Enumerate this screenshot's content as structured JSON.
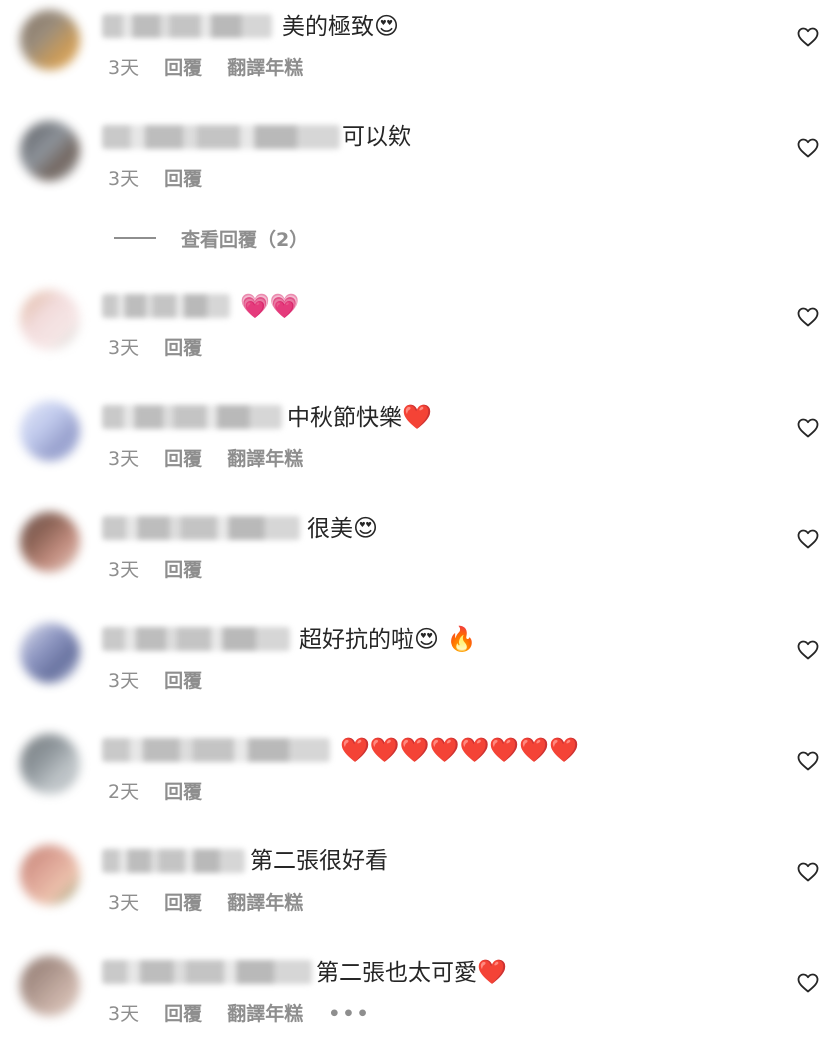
{
  "comments": [
    {
      "id": 1,
      "text": "美的極致",
      "emoji": "😍",
      "time": "3天",
      "reply": "回覆",
      "translate": "翻譯年糕",
      "avatar_colors": [
        "#6b5a4a",
        "#c08a3e",
        "#8a7a66",
        "#e2a24a"
      ]
    },
    {
      "id": 2,
      "text": "可以欸",
      "emoji": "",
      "time": "3天",
      "reply": "回覆",
      "translate": "",
      "avatar_colors": [
        "#3b3f45",
        "#7a8088",
        "#5a4c44",
        "#a3a8ad"
      ]
    },
    {
      "id": 3,
      "text": "",
      "emoji": "💗💗",
      "time": "3天",
      "reply": "回覆",
      "translate": "",
      "avatar_colors": [
        "#f0d6d6",
        "#d9a88d",
        "#f5e2e2",
        "#c9d6cf"
      ]
    },
    {
      "id": 4,
      "text": "中秋節快樂",
      "emoji": "❤️",
      "time": "3天",
      "reply": "回覆",
      "translate": "翻譯年糕",
      "avatar_colors": [
        "#b7c2ea",
        "#8892c6",
        "#dfe4f7",
        "#9aa7d8"
      ]
    },
    {
      "id": 5,
      "text": "很美",
      "emoji": "😍",
      "time": "3天",
      "reply": "回覆",
      "translate": "",
      "avatar_colors": [
        "#5a3b35",
        "#b87a6a",
        "#e0c4b8",
        "#7a4a3a"
      ]
    },
    {
      "id": 6,
      "text": "超好抗的啦",
      "emoji": "😍 🔥",
      "time": "3天",
      "reply": "回覆",
      "translate": "",
      "avatar_colors": [
        "#7c86b8",
        "#c2c9e6",
        "#4e5a8f",
        "#d9dcec"
      ]
    },
    {
      "id": 7,
      "text": "",
      "emoji": "❤️❤️❤️❤️❤️❤️❤️❤️",
      "time": "2天",
      "reply": "回覆",
      "translate": "",
      "avatar_colors": [
        "#7d868c",
        "#b5bcc0",
        "#5d6468",
        "#a8afb3"
      ]
    },
    {
      "id": 8,
      "text": "第二張很好看",
      "emoji": "",
      "time": "3天",
      "reply": "回覆",
      "translate": "翻譯年糕",
      "avatar_colors": [
        "#b86b5a",
        "#e9b79e",
        "#6b8a55",
        "#d89585"
      ]
    },
    {
      "id": 9,
      "text": "第二張也太可愛",
      "emoji": "❤️",
      "time": "3天",
      "reply": "回覆",
      "translate": "翻譯年糕",
      "more": "•••",
      "avatar_colors": [
        "#a0857a",
        "#d6c2b8",
        "#7a6056",
        "#c4a89c"
      ]
    }
  ],
  "view_replies": {
    "label": "查看回覆（2）"
  },
  "colors": {
    "text": "#262626",
    "muted": "#8e8e8e"
  },
  "icons": {
    "like": "heart-outline-icon",
    "more": "more-dots-icon"
  }
}
